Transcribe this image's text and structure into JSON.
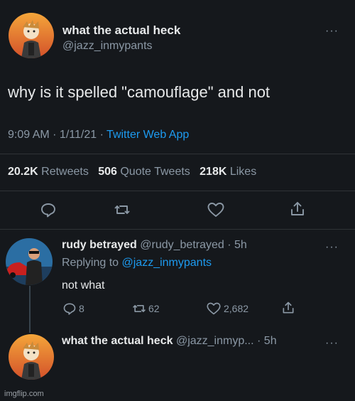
{
  "tweet": {
    "display_name": "what the actual heck",
    "handle": "@jazz_inmypants",
    "more": "···",
    "text": "why is it spelled \"camouflage\" and not",
    "time": "9:09 AM · 1/11/21 · ",
    "source": "Twitter Web App",
    "stats": {
      "retweets_count": "20.2K",
      "retweets_label": "Retweets",
      "quotes_count": "506",
      "quotes_label": "Quote Tweets",
      "likes_count": "218K",
      "likes_label": "Likes"
    }
  },
  "reply": {
    "display_name": "rudy betrayed",
    "handle_time": "@rudy_betrayed · 5h",
    "replying_prefix": "Replying to",
    "replying_handle": "@jazz_inmypants",
    "text": "not what",
    "more": "···",
    "reply_count": "8",
    "retweet_count": "62",
    "like_count": "2,682"
  },
  "next_reply": {
    "display_name": "what the actual heck",
    "handle": "@jazz_inmyp...",
    "time": "· 5h",
    "more": "···"
  },
  "watermark": "imgflip.com",
  "colors": {
    "background": "#15181c",
    "text": "#e7e9ea",
    "muted": "#8b98a5",
    "accent": "#1d9bf0"
  },
  "icons": {
    "reply": "reply-icon",
    "retweet": "retweet-icon",
    "like": "heart-icon",
    "share": "share-icon",
    "more": "more-icon"
  }
}
